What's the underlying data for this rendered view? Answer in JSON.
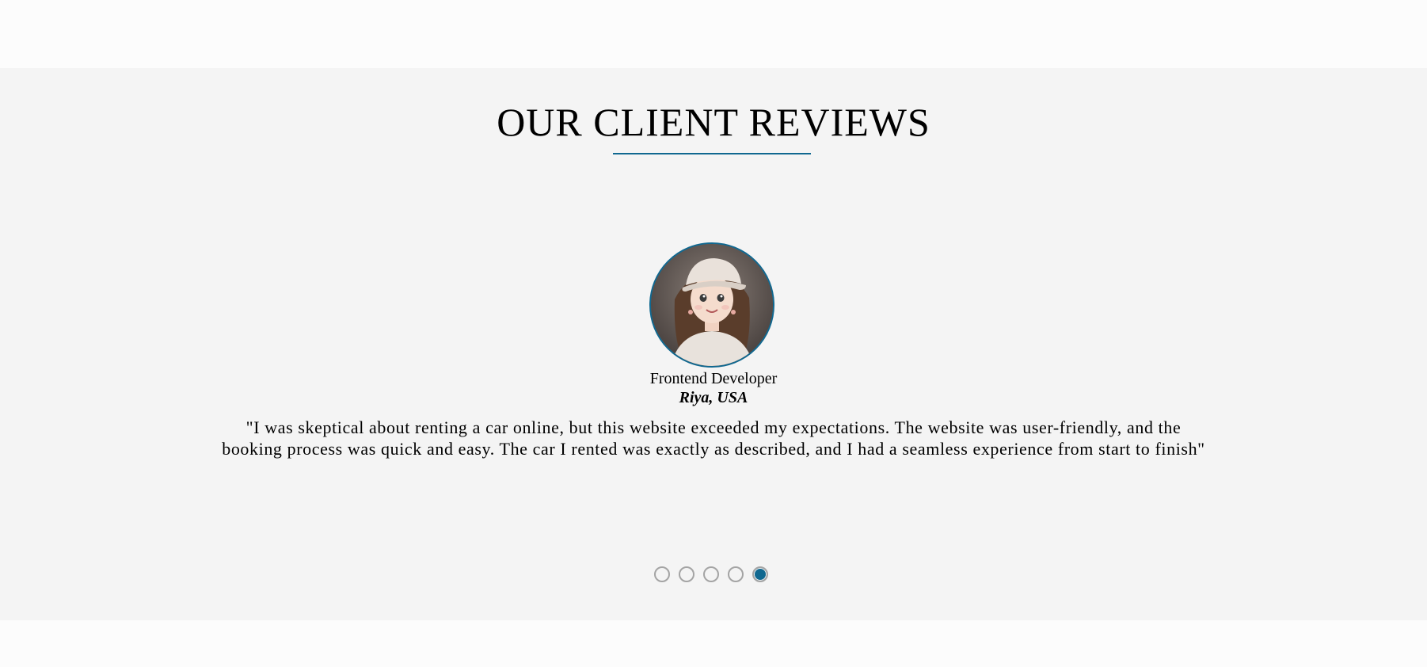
{
  "section": {
    "title": "OUR CLIENT REVIEWS"
  },
  "colors": {
    "accent": "#106890",
    "section_background": "#f4f4f4",
    "page_background": "#fcfcfc",
    "dot_inactive": "#a4a4a4"
  },
  "review": {
    "avatar_icon": "reviewer-avatar-photo",
    "role": "Frontend Developer",
    "name": "Riya, USA",
    "text": "\"I was skeptical about renting a car online, but this website exceeded my expectations. The website was user-friendly, and the booking process was quick and easy. The car I rented was exactly as described, and I had a seamless experience from start to finish\""
  },
  "carousel": {
    "total_slides": 5,
    "active_slide": 5
  }
}
